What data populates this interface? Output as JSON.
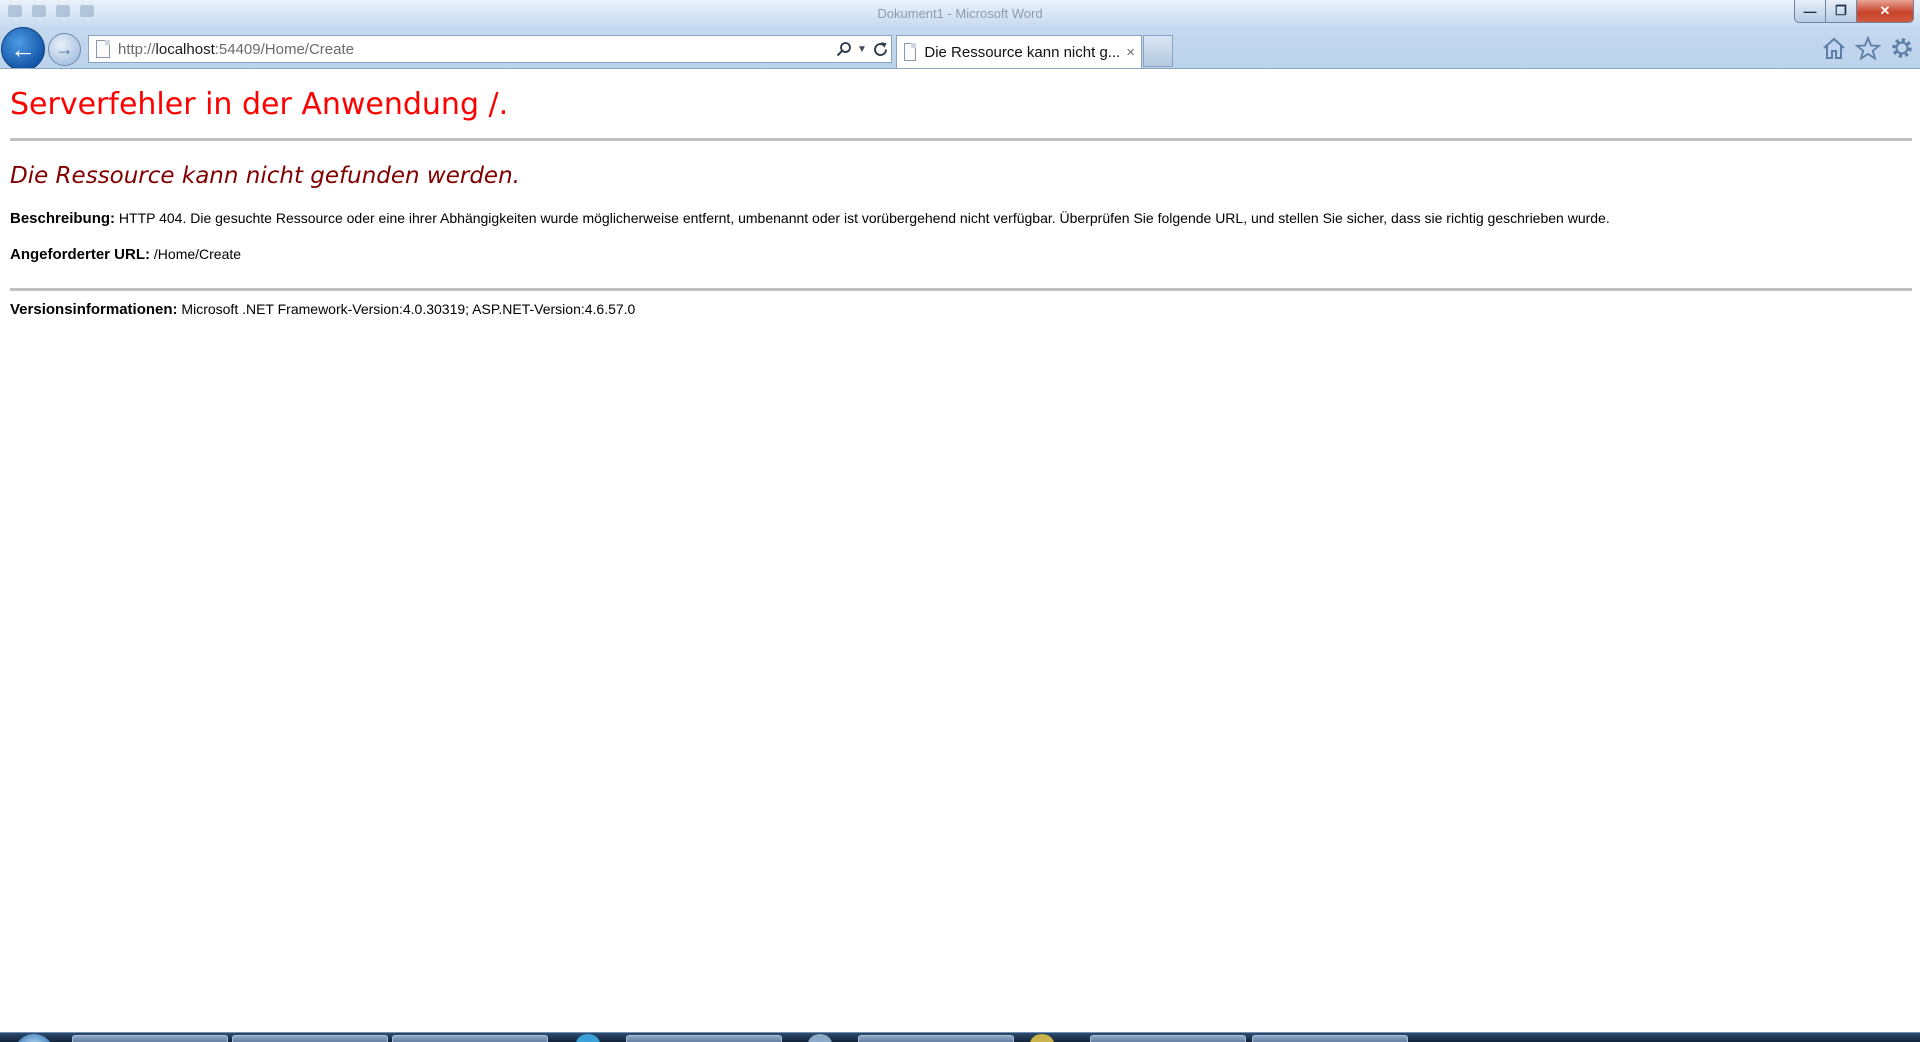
{
  "window": {
    "title": "Dokument1 - Microsoft Word"
  },
  "browser": {
    "address_protocol": "http://",
    "address_host": "localhost",
    "address_rest": ":54409/Home/Create",
    "tab_title": "Die Ressource kann nicht g...",
    "tab_close": "×"
  },
  "page": {
    "heading": "Serverfehler in der Anwendung /.",
    "subheading": "Die Ressource kann nicht gefunden werden.",
    "description_label": "Beschreibung:",
    "description_text": "HTTP 404. Die gesuchte Ressource oder eine ihrer Abhängigkeiten wurde möglicherweise entfernt, umbenannt oder ist vorübergehend nicht verfügbar. Überprüfen Sie folgende URL, und stellen Sie sicher, dass sie richtig geschrieben wurde.",
    "url_label": "Angeforderter URL:",
    "url_value": "/Home/Create",
    "version_label": "Versionsinformationen:",
    "version_value": "Microsoft .NET Framework-Version:4.0.30319; ASP.NET-Version:4.6.57.0"
  },
  "icons": {
    "back": "back-arrow-icon",
    "forward": "forward-arrow-icon",
    "search": "search-icon",
    "refresh": "refresh-icon",
    "home": "home-icon",
    "favorites": "star-icon",
    "tools": "gear-icon"
  },
  "colors": {
    "heading": "#ff0000",
    "subheading": "#800000",
    "rule": "#c0c0c0"
  }
}
